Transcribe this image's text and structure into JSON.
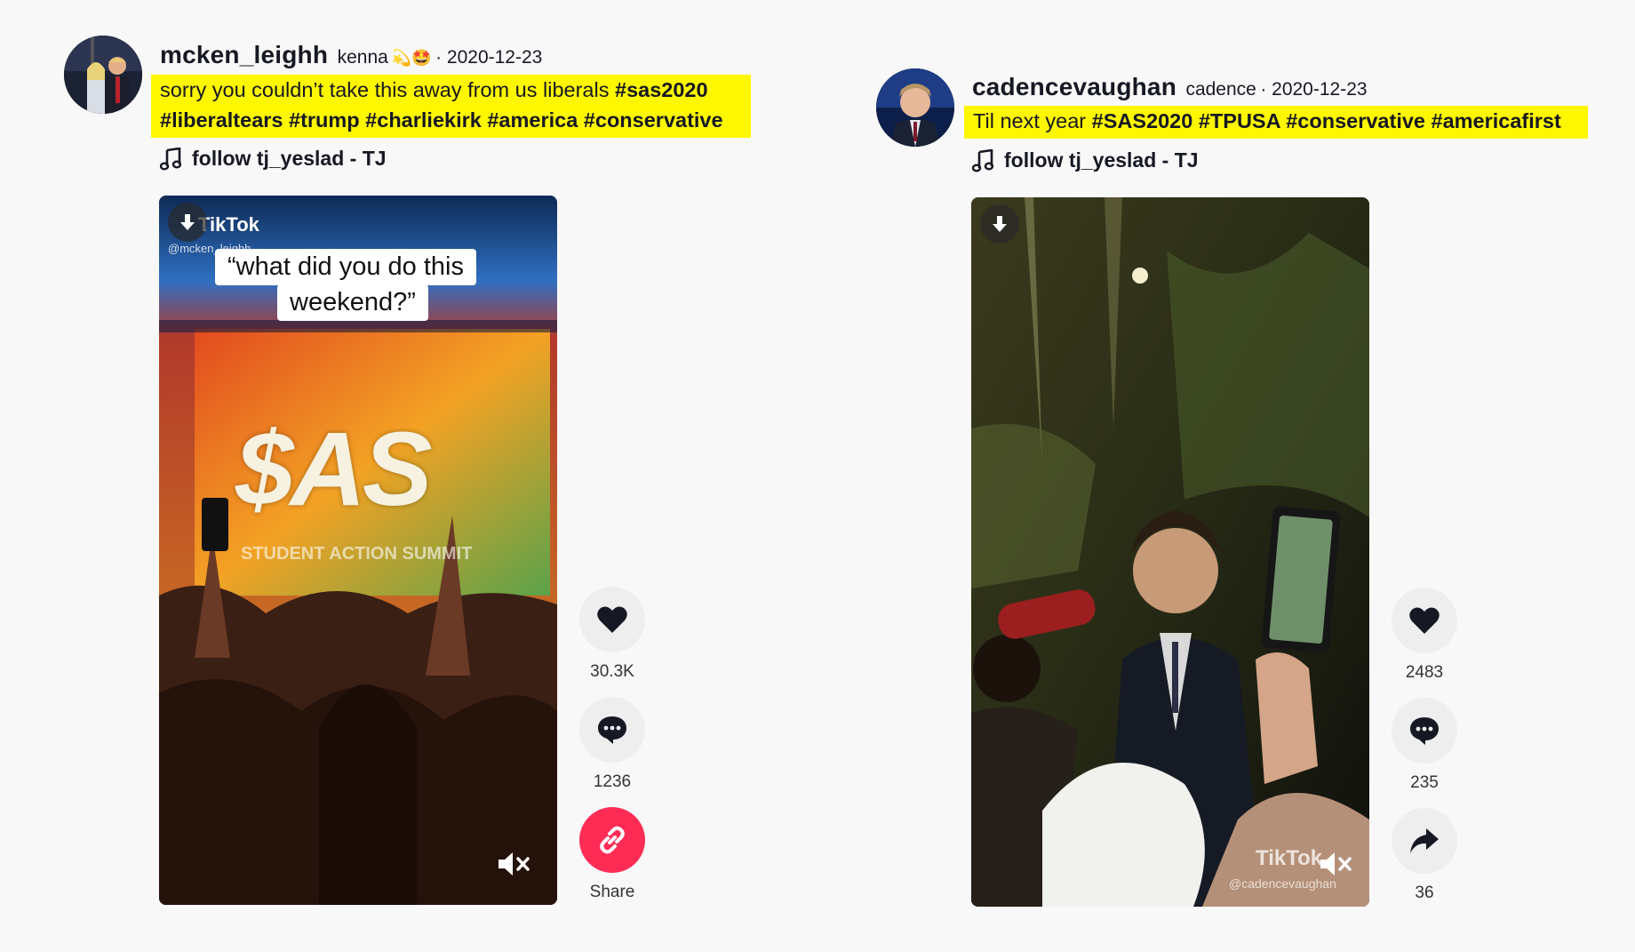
{
  "posts": [
    {
      "username": "mcken_leighh",
      "nickname": "kenna",
      "emoji": "💫🤩",
      "date": "· 2020-12-23",
      "caption_text_1": "sorry you couldn’t take this away from us liberals ",
      "caption_tag_1": "#sas2020",
      "caption_tags_2": "#liberaltears #trump #charliekirk #america #conservative",
      "music": "follow tj_yeslad - TJ",
      "overlay_text_1": "“what did you do this",
      "overlay_text_2": "weekend?”",
      "watermark": "TikTok",
      "watermark_handle": "@mcken_leighh",
      "stage_logo": "$AS",
      "stage_subtitle": "STUDENT ACTION SUMMIT",
      "likes": "30.3K",
      "comments": "1236",
      "share_label": "Share"
    },
    {
      "username": "cadencevaughan",
      "nickname": "cadence",
      "date": "· 2020-12-23",
      "caption_text_1": "Til next year ",
      "caption_tags_1": "#SAS2020 #TPUSA #conservative #americafirst",
      "music": "follow tj_yeslad - TJ",
      "watermark": "TikTok",
      "watermark_handle": "@cadencevaughan",
      "likes": "2483",
      "comments": "235",
      "shares": "36"
    }
  ],
  "colors": {
    "highlight": "#fff700",
    "share_accent": "#fe2c55",
    "action_bg": "#eeeeee"
  },
  "icons": [
    "music-note-icon",
    "download-icon",
    "mute-icon",
    "heart-icon",
    "comment-icon",
    "link-icon",
    "share-arrow-icon"
  ]
}
